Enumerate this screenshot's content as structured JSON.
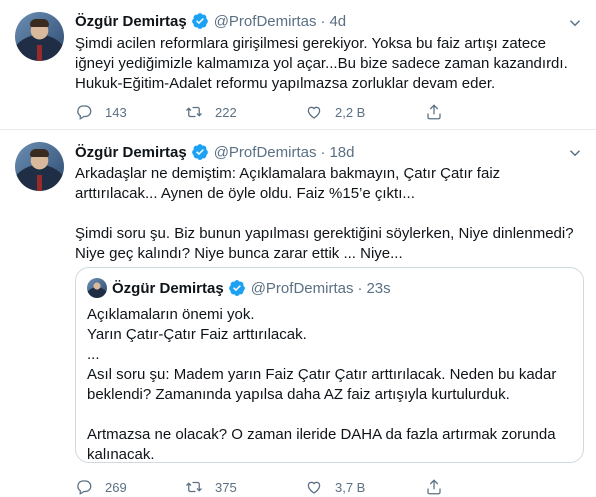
{
  "colors": {
    "accent": "#1da1f2",
    "muted": "#5b7083",
    "border": "#e6ecf0"
  },
  "tweets": [
    {
      "author_name": "Özgür Demirtaş",
      "handle": "@ProfDemirtas",
      "separator": "·",
      "time": "4d",
      "text": "Şimdi acilen reformlara girişilmesi gerekiyor. Yoksa bu faiz artışı zatece iğneyi yediğimizle kalmamıza yol açar...Bu bize sadece zaman kazandırdı. Hukuk-Eğitim-Adalet reformu yapılmazsa zorluklar devam eder.",
      "replies": "143",
      "retweets": "222",
      "likes": "2,2 B"
    },
    {
      "author_name": "Özgür Demirtaş",
      "handle": "@ProfDemirtas",
      "separator": "·",
      "time": "18d",
      "text": "Arkadaşlar ne demiştim: Açıklamalara bakmayın, Çatır Çatır faiz arttırılacak... Aynen de öyle oldu. Faiz %15’e çıktı...\n\nŞimdi soru şu. Biz bunun yapılması gerektiğini söylerken, Niye dinlenmedi? Niye geç kalındı? Niye bunca zarar ettik ... Niye...",
      "quote": {
        "author_name": "Özgür Demirtaş",
        "handle": "@ProfDemirtas",
        "separator": "·",
        "time": "23s",
        "text": "Açıklamaların önemi yok.\nYarın Çatır-Çatır Faiz arttırılacak.\n...\nAsıl soru şu: Madem yarın Faiz Çatır Çatır arttırılacak. Neden bu kadar beklendi? Zamanında yapılsa daha AZ faiz artışıyla kurtulurduk.\n\nArtmazsa ne olacak? O zaman ileride DAHA da fazla artırmak zorunda kalınacak."
      },
      "replies": "269",
      "retweets": "375",
      "likes": "3,7 B"
    }
  ],
  "icons": {
    "verified": "verified-badge-icon",
    "more": "chevron-down-icon",
    "reply": "reply-icon",
    "retweet": "retweet-icon",
    "like": "heart-icon",
    "share": "share-icon"
  }
}
